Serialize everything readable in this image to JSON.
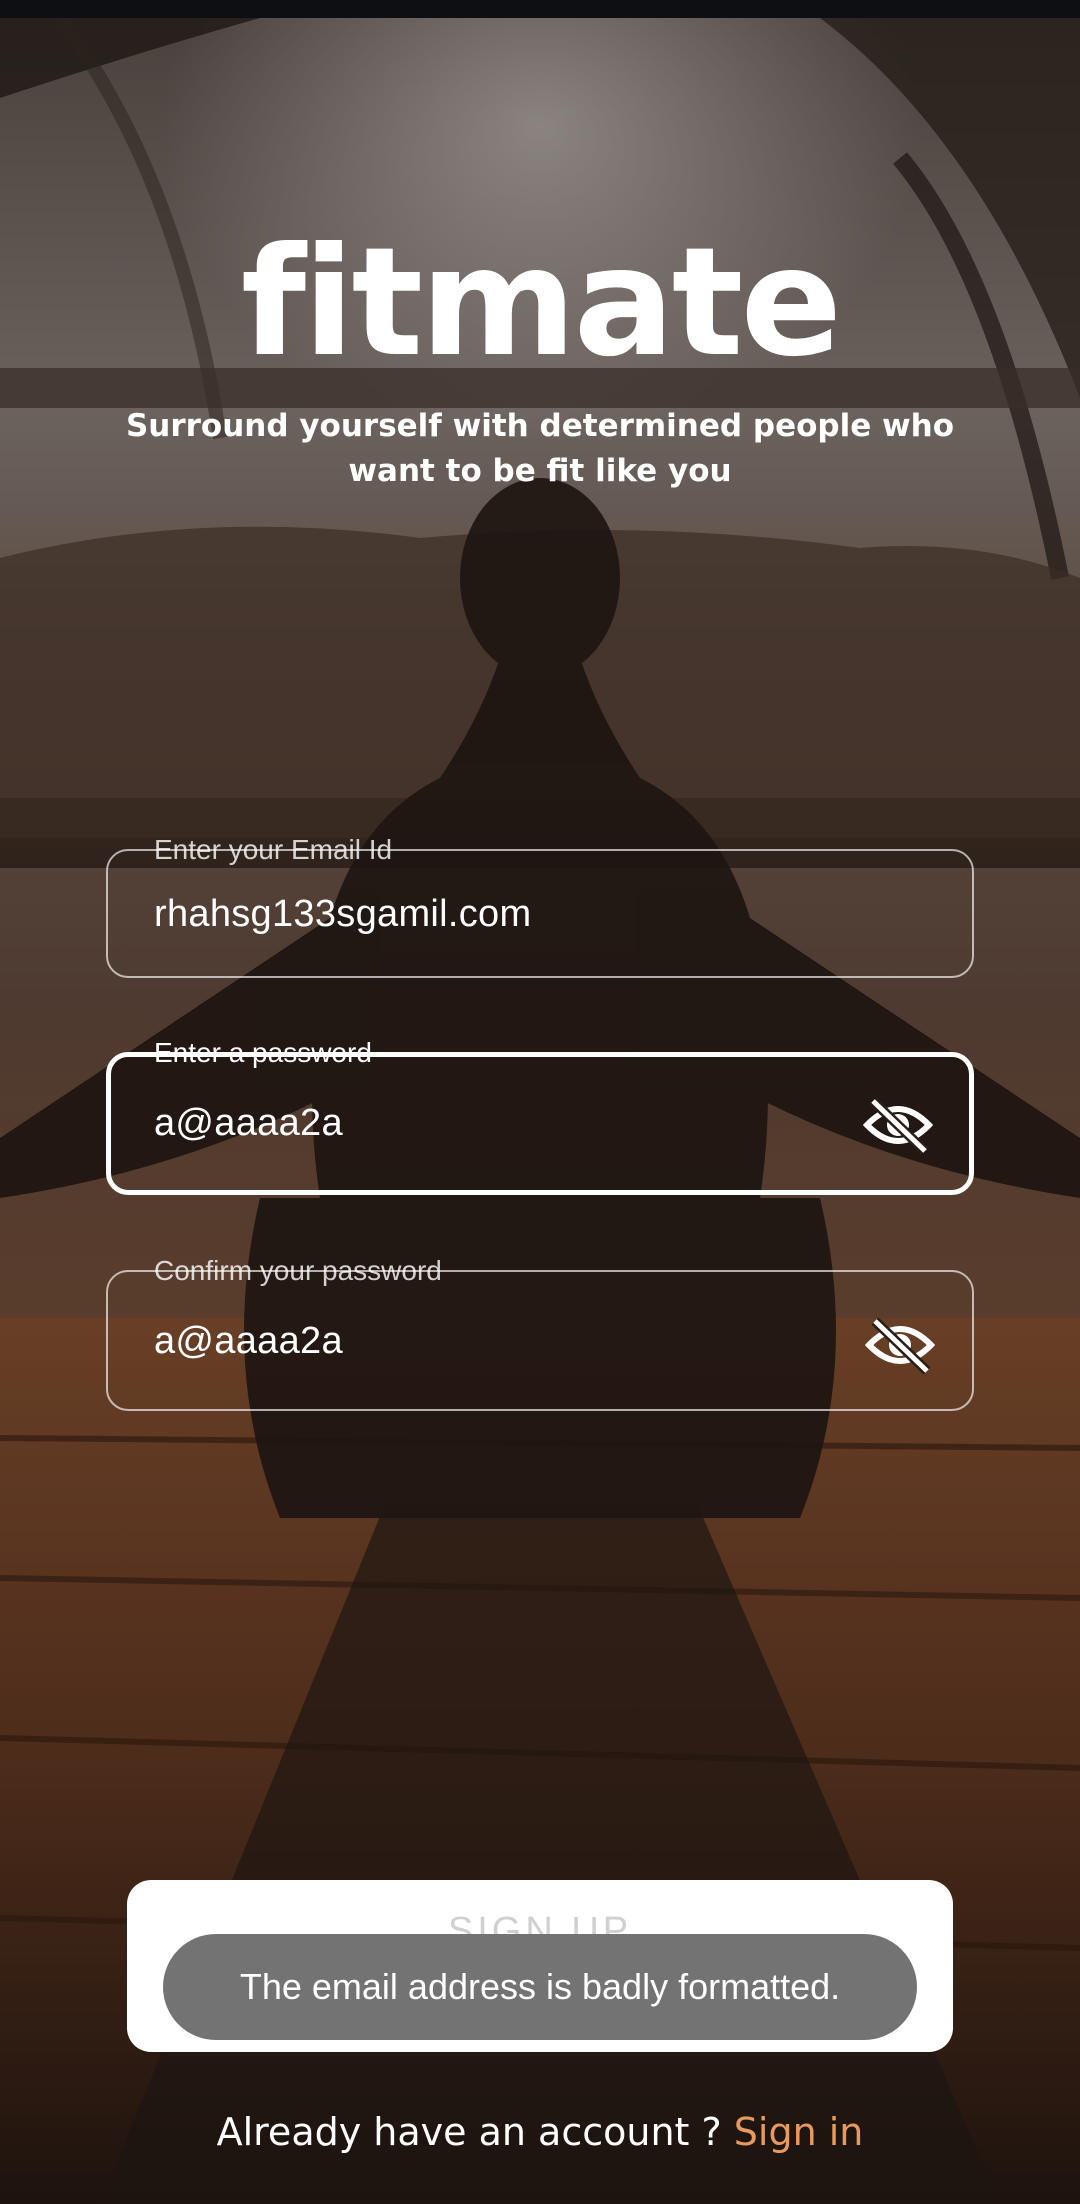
{
  "app": {
    "logo_text": "fitmate",
    "tagline": "Surround yourself with determined people who want to be fit like you"
  },
  "form": {
    "email": {
      "label": "Enter your Email Id",
      "value": "rhahsg133sgamil.com"
    },
    "password": {
      "label": "Enter a password",
      "value": "a@aaaa2a",
      "toggle_icon": "eye-off-icon"
    },
    "confirm_password": {
      "label": "Confirm your password",
      "value": "a@aaaa2a",
      "toggle_icon": "eye-off-icon"
    },
    "submit_label": "SIGN UP"
  },
  "toast": {
    "message": "The email address is badly formatted."
  },
  "footer": {
    "prompt": "Already have an account ? ",
    "link_label": "Sign in"
  },
  "colors": {
    "link": "#e89a5e",
    "toast_bg": "#737373",
    "card_bg": "#ffffff"
  }
}
